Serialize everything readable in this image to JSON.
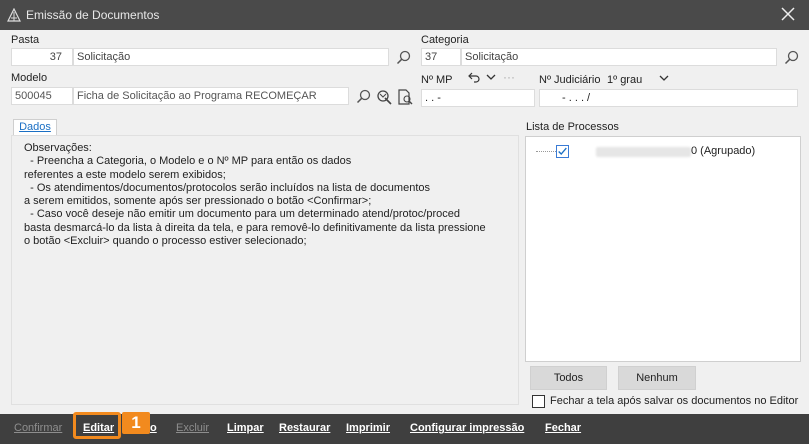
{
  "window": {
    "title": "Emissão de Documentos",
    "icon": "app-logo-icon",
    "close_icon": "close-icon"
  },
  "pasta": {
    "label": "Pasta",
    "code": "37",
    "name": "Solicitação"
  },
  "categoria": {
    "label": "Categoria",
    "code": "37",
    "name": "Solicitação"
  },
  "modelo": {
    "label": "Modelo",
    "code": "500045",
    "name": "Ficha de Solicitação ao Programa RECOMEÇAR"
  },
  "nmp": {
    "label": "Nº MP",
    "value": ".   .        -"
  },
  "judiciario": {
    "label": "Nº Judiciário",
    "grau": "1º grau",
    "value": "-   .   .    .    /"
  },
  "tabs": {
    "dados": "Dados"
  },
  "observacoes": "Observações:\n  - Preencha a Categoria, o Modelo e o Nº MP para então os dados\nreferentes a este modelo serem exibidos;\n  - Os atendimentos/documentos/protocolos serão incluídos na lista de documentos\na serem emitidos, somente após ser pressionado o botão <Confirmar>;\n  - Caso você deseje não emitir um documento para um determinado atend/protoc/proced\nbasta desmarcá-lo da lista à direita da tela, e para removê-lo definitivamente da lista pressione\no botão <Excluir> quando o processo estiver selecionado;",
  "processos": {
    "label": "Lista de Processos",
    "items": [
      {
        "suffix": "0 (Agrupado)",
        "checked": true
      }
    ],
    "todos_label": "Todos",
    "nenhum_label": "Nenhum",
    "fechar_label": "Fechar a tela após salvar os documentos no Editor"
  },
  "footer": {
    "confirmar": "Confirmar",
    "editar": "Editar",
    "o": "o",
    "excluir": "Excluir",
    "limpar": "Limpar",
    "restaurar": "Restaurar",
    "imprimir": "Imprimir",
    "configurar": "Configurar impressão",
    "fechar": "Fechar"
  },
  "annotation": {
    "badge": "1",
    "color": "#f28a1e"
  },
  "colors": {
    "titlebar": "#4a4a4a",
    "footer": "#3f3f3f",
    "accent": "#1a6fc4"
  }
}
